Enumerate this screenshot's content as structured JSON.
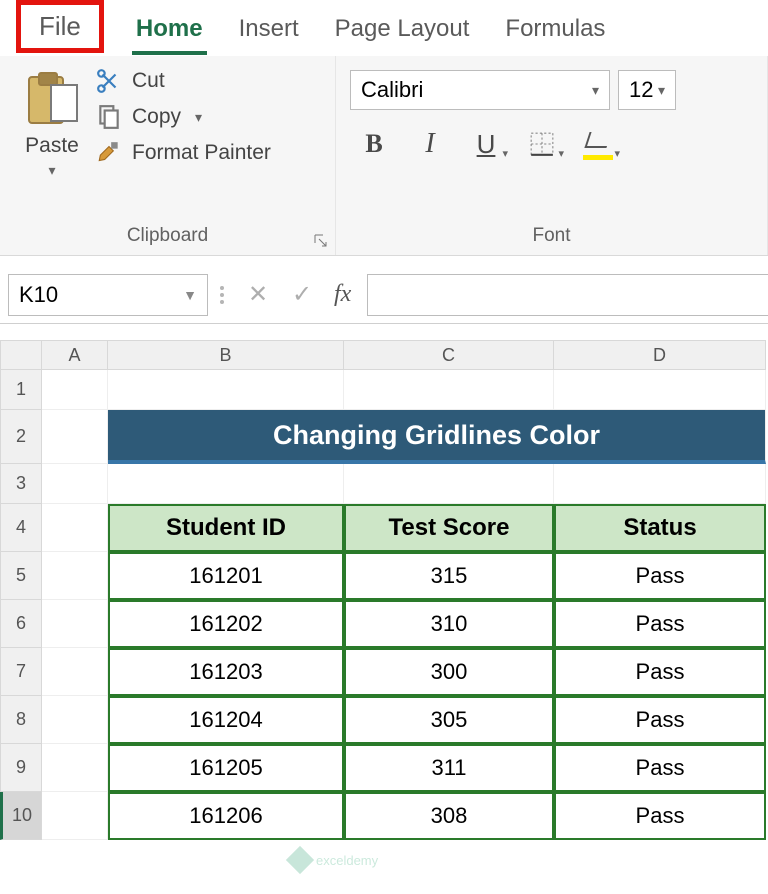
{
  "tabs": {
    "file": "File",
    "home": "Home",
    "insert": "Insert",
    "pageLayout": "Page Layout",
    "formulas": "Formulas"
  },
  "clipboard": {
    "paste": "Paste",
    "cut": "Cut",
    "copy": "Copy",
    "formatPainter": "Format Painter",
    "groupLabel": "Clipboard"
  },
  "font": {
    "family": "Calibri",
    "size": "12",
    "bold": "B",
    "italic": "I",
    "underline": "U",
    "groupLabel": "Font"
  },
  "nameBox": "K10",
  "fxLabel": "fx",
  "columns": {
    "A": "A",
    "B": "B",
    "C": "C",
    "D": "D"
  },
  "rowNums": [
    "1",
    "2",
    "3",
    "4",
    "5",
    "6",
    "7",
    "8",
    "9",
    "10"
  ],
  "sheet": {
    "title": "Changing Gridlines Color",
    "headers": {
      "id": "Student ID",
      "score": "Test Score",
      "status": "Status"
    },
    "rows": [
      {
        "id": "161201",
        "score": "315",
        "status": "Pass"
      },
      {
        "id": "161202",
        "score": "310",
        "status": "Pass"
      },
      {
        "id": "161203",
        "score": "300",
        "status": "Pass"
      },
      {
        "id": "161204",
        "score": "305",
        "status": "Pass"
      },
      {
        "id": "161205",
        "score": "311",
        "status": "Pass"
      },
      {
        "id": "161206",
        "score": "308",
        "status": "Pass"
      }
    ]
  },
  "watermark": "exceldemy"
}
